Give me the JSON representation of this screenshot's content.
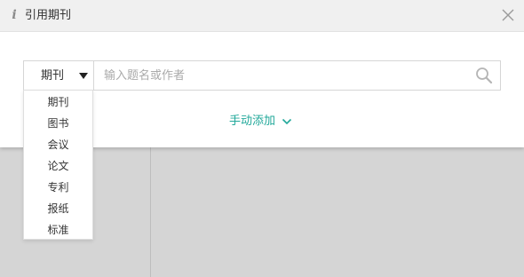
{
  "dialog": {
    "title": "引用期刊",
    "info_icon": "i",
    "close_icon_name": "close-icon"
  },
  "search": {
    "selected_type": "期刊",
    "placeholder": "输入题名或作者",
    "value": ""
  },
  "manual_add": {
    "label": "手动添加"
  },
  "dropdown": {
    "options": [
      "期刊",
      "图书",
      "会议",
      "论文",
      "专利",
      "报纸",
      "标准"
    ]
  },
  "colors": {
    "accent": "#21a89a",
    "header_bg": "#f0f0f0",
    "overlay_bg": "#d5d5d5"
  }
}
